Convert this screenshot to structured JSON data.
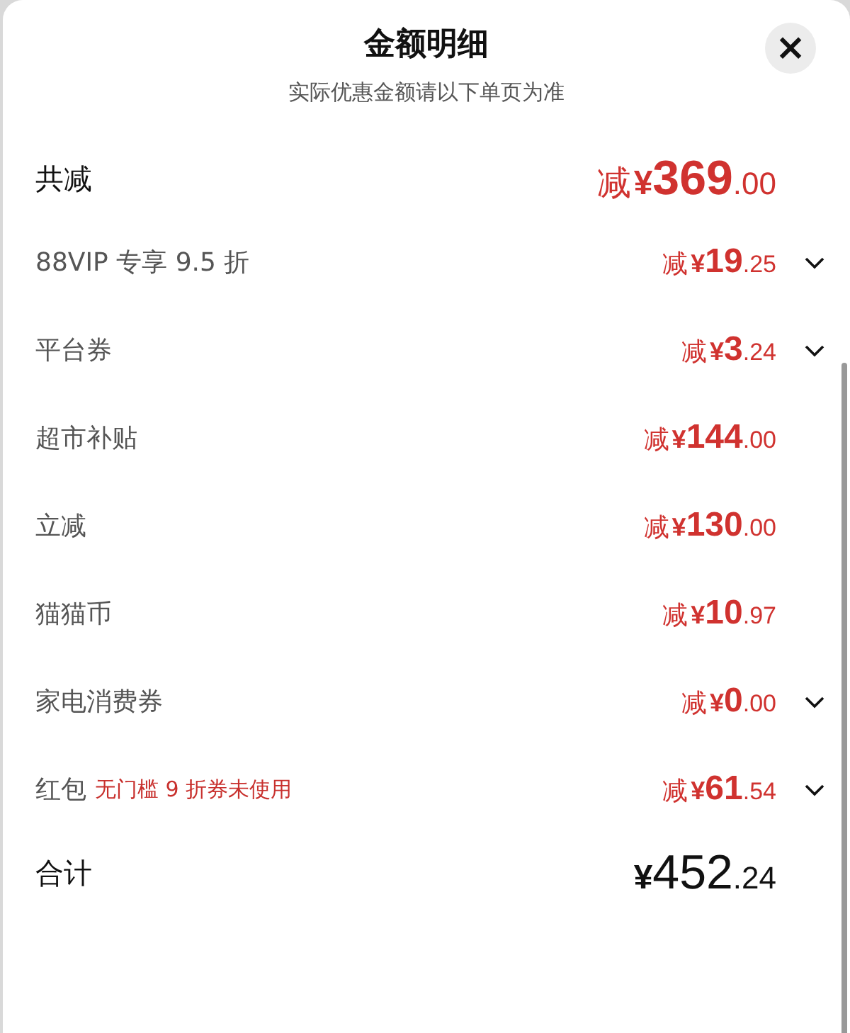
{
  "header": {
    "title": "金额明细",
    "subtitle": "实际优惠金额请以下单页为准",
    "close": "×"
  },
  "total_discount": {
    "label": "共减",
    "amount": {
      "prefix": "减",
      "currency": "¥",
      "integer": "369",
      "decimal": ".00"
    }
  },
  "items": [
    {
      "label": "88VIP 专享 9.5 折",
      "amount": {
        "prefix": "减",
        "currency": "¥",
        "integer": "19",
        "decimal": ".25"
      },
      "expandable": true
    },
    {
      "label": "平台券",
      "amount": {
        "prefix": "减",
        "currency": "¥",
        "integer": "3",
        "decimal": ".24"
      },
      "expandable": true
    },
    {
      "label": "超市补贴",
      "amount": {
        "prefix": "减",
        "currency": "¥",
        "integer": "144",
        "decimal": ".00"
      },
      "expandable": false
    },
    {
      "label": "立减",
      "amount": {
        "prefix": "减",
        "currency": "¥",
        "integer": "130",
        "decimal": ".00"
      },
      "expandable": false
    },
    {
      "label": "猫猫币",
      "amount": {
        "prefix": "减",
        "currency": "¥",
        "integer": "10",
        "decimal": ".97"
      },
      "expandable": false
    },
    {
      "label": "家电消费券",
      "amount": {
        "prefix": "减",
        "currency": "¥",
        "integer": "0",
        "decimal": ".00"
      },
      "expandable": true
    },
    {
      "label": "红包",
      "note": "无门槛 9 折券未使用",
      "amount": {
        "prefix": "减",
        "currency": "¥",
        "integer": "61",
        "decimal": ".54"
      },
      "expandable": true
    }
  ],
  "total": {
    "label": "合计",
    "amount": {
      "currency": "¥",
      "integer": "452",
      "decimal": ".24"
    }
  }
}
